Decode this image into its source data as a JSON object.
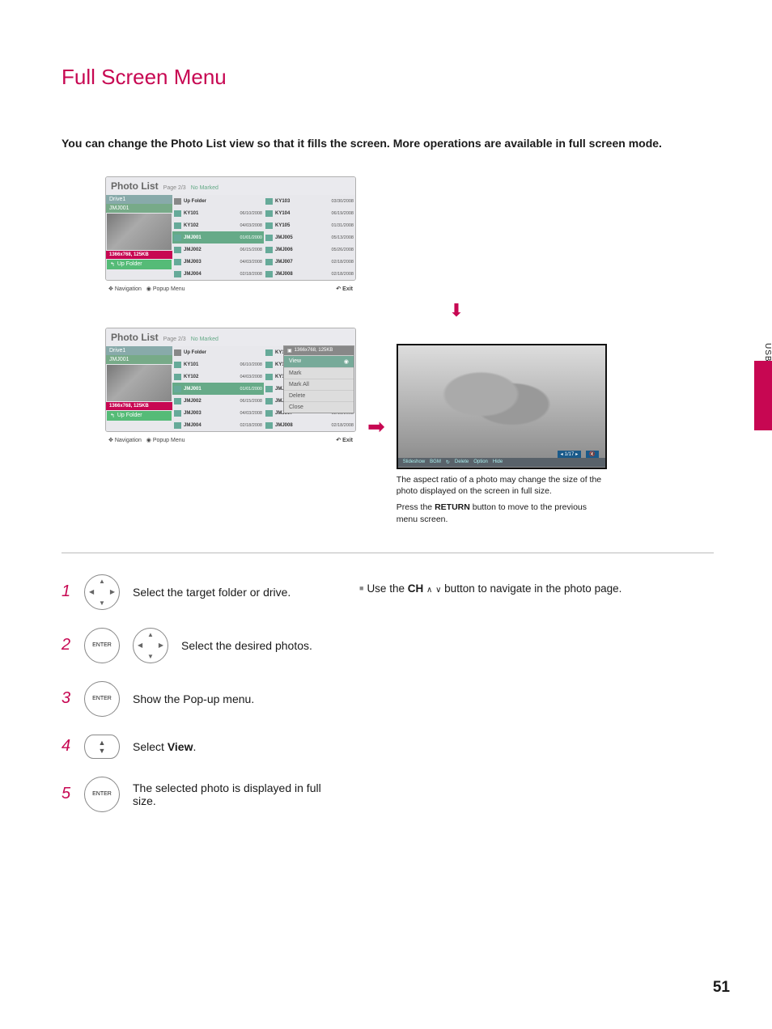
{
  "sideLabel": "USB",
  "title": "Full Screen Menu",
  "intro": "You can change the Photo List view so that it fills the screen. More operations are available in full screen mode.",
  "panel": {
    "title": "Photo List",
    "page": "Page 2/3",
    "noMarked": "No Marked",
    "drive": "Drive1",
    "folder": "JMJ001",
    "resolution": "1366x768, 125KB",
    "upFolder": "Up Folder",
    "col1": [
      {
        "type": "fld",
        "name": "Up Folder",
        "date": ""
      },
      {
        "type": "ic",
        "name": "KY101",
        "date": "06/10/2008"
      },
      {
        "type": "ic",
        "name": "KY102",
        "date": "04/03/2008"
      },
      {
        "type": "ic",
        "name": "JMJ001",
        "date": "01/01/2000",
        "sel": true
      },
      {
        "type": "ic",
        "name": "JMJ002",
        "date": "06/15/2008"
      },
      {
        "type": "ic",
        "name": "JMJ003",
        "date": "04/03/2008"
      },
      {
        "type": "ic",
        "name": "JMJ004",
        "date": "02/18/2008"
      }
    ],
    "col2": [
      {
        "type": "ic",
        "name": "KY103",
        "date": "03/30/2008"
      },
      {
        "type": "ic",
        "name": "KY104",
        "date": "06/19/2008"
      },
      {
        "type": "ic",
        "name": "KY105",
        "date": "01/31/2008"
      },
      {
        "type": "ic",
        "name": "JMJ005",
        "date": "05/13/2008"
      },
      {
        "type": "ic",
        "name": "JMJ006",
        "date": "05/26/2008"
      },
      {
        "type": "ic",
        "name": "JMJ007",
        "date": "02/18/2008"
      },
      {
        "type": "ic",
        "name": "JMJ008",
        "date": "02/18/2008"
      }
    ],
    "footerLeft1": "Navigation",
    "footerLeft2": "Popup Menu",
    "footerRight": "Exit"
  },
  "popup": {
    "header": "1366x768, 125KB",
    "items": [
      "View",
      "Mark",
      "Mark All",
      "Delete",
      "Close"
    ]
  },
  "tv": {
    "counter": "1/17",
    "controls": [
      "Slideshow",
      "BGM",
      "Delete",
      "Option",
      "Hide"
    ],
    "note1": "The aspect ratio of a photo may change the size of the photo displayed on the screen in full size.",
    "note2a": "Press the ",
    "note2b": "RETURN",
    "note2c": " button to move to the previous menu screen."
  },
  "steps": [
    {
      "n": "1",
      "txt": "Select the target folder or drive."
    },
    {
      "n": "2",
      "txt": "Select the desired photos."
    },
    {
      "n": "3",
      "txt": "Show the Pop-up menu."
    },
    {
      "n": "4",
      "txt_pre": "Select ",
      "txt_b": "View",
      "txt_post": "."
    },
    {
      "n": "5",
      "txt": "The selected photo is displayed in full size."
    }
  ],
  "tip": {
    "pre": "Use the ",
    "b": "CH",
    "mid": "     button to navigate in the photo page."
  },
  "pageNum": "51"
}
